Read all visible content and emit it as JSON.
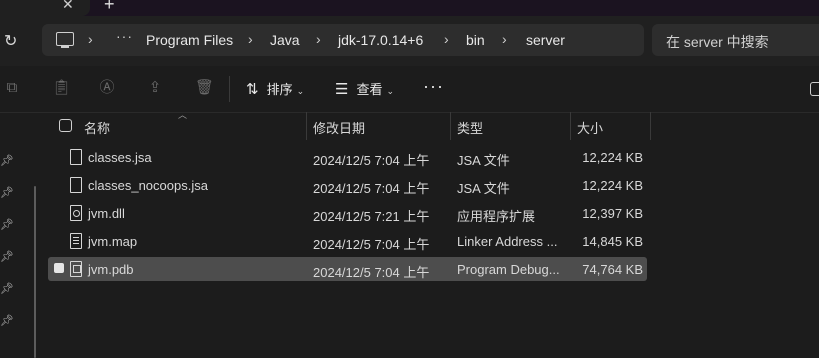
{
  "window": {
    "new_tab_label": "+",
    "close_tab_label": "✕"
  },
  "address_bar": {
    "more_label": "···",
    "breadcrumbs": [
      "Program Files",
      "Java",
      "jdk-17.0.14+6",
      "bin",
      "server"
    ],
    "search_placeholder": "在 server 中搜索"
  },
  "toolbar": {
    "sort_label": "排序",
    "view_label": "查看",
    "more_label": "···"
  },
  "columns": {
    "name": "名称",
    "modified": "修改日期",
    "type": "类型",
    "size": "大小"
  },
  "files": [
    {
      "name": "classes.jsa",
      "modified": "2024/12/5 7:04 上午",
      "type": "JSA 文件",
      "size": "12,224 KB",
      "icon": "file-icon"
    },
    {
      "name": "classes_nocoops.jsa",
      "modified": "2024/12/5 7:04 上午",
      "type": "JSA 文件",
      "size": "12,224 KB",
      "icon": "file-icon"
    },
    {
      "name": "jvm.dll",
      "modified": "2024/12/5 7:21 上午",
      "type": "应用程序扩展",
      "size": "12,397 KB",
      "icon": "dll-file-icon"
    },
    {
      "name": "jvm.map",
      "modified": "2024/12/5 7:04 上午",
      "type": "Linker Address ...",
      "size": "14,845 KB",
      "icon": "text-file-icon"
    },
    {
      "name": "jvm.pdb",
      "modified": "2024/12/5 7:04 上午",
      "type": "Program Debug...",
      "size": "74,764 KB",
      "icon": "pdb-file-icon",
      "selected": true
    }
  ],
  "colors": {
    "background": "#1c1c1c",
    "selected_row": "#4d4d4d",
    "text": "#d8d8d8"
  }
}
